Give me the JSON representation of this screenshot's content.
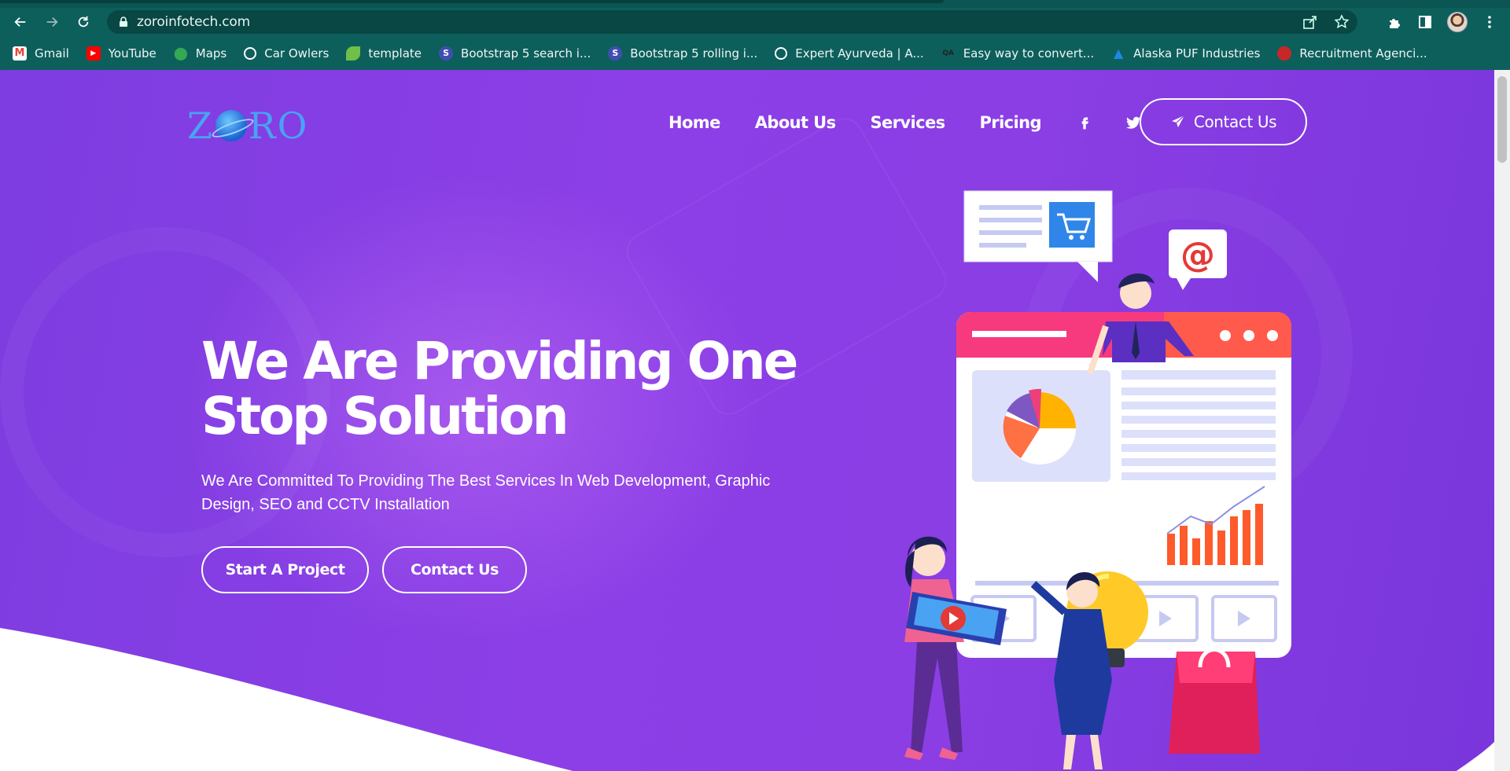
{
  "browser": {
    "url": "zoroinfotech.com",
    "bookmarks": [
      {
        "label": "Gmail",
        "icon": "gmail-icon"
      },
      {
        "label": "YouTube",
        "icon": "youtube-icon"
      },
      {
        "label": "Maps",
        "icon": "maps-icon"
      },
      {
        "label": "Car Owlers",
        "icon": "globe-icon"
      },
      {
        "label": "template",
        "icon": "leaf-icon"
      },
      {
        "label": "Bootstrap 5 search i...",
        "icon": "bootstrap-icon"
      },
      {
        "label": "Bootstrap 5 rolling i...",
        "icon": "bootstrap-icon"
      },
      {
        "label": "Expert Ayurveda | A...",
        "icon": "globe-icon"
      },
      {
        "label": "Easy way to convert...",
        "icon": "qa-icon"
      },
      {
        "label": "Alaska PUF Industries",
        "icon": "alaska-icon"
      },
      {
        "label": "Recruitment Agenci...",
        "icon": "red-circle-icon"
      }
    ]
  },
  "site": {
    "logo_text_left": "Z",
    "logo_text_right": "RO",
    "nav": {
      "home": "Home",
      "about": "About Us",
      "services": "Services",
      "pricing": "Pricing"
    },
    "contact_button": "Contact Us",
    "hero": {
      "headline_line1": "We Are Providing One",
      "headline_line2": "Stop Solution",
      "subtext": "We Are Committed To Providing The Best Services In Web Development, Graphic Design, SEO and CCTV Installation",
      "primary_button": "Start A Project",
      "secondary_button": "Contact Us"
    },
    "illustration": {
      "email_symbol": "@"
    }
  },
  "colors": {
    "chrome": "#0d5f5c",
    "hero_purple": "#8c3fe6",
    "logo_blue": "#4aa2f2"
  }
}
